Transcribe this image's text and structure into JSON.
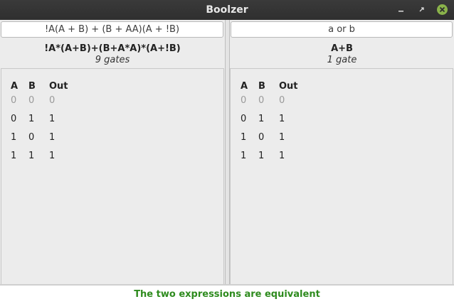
{
  "window": {
    "title": "Boolzer",
    "controls": [
      "minimize-icon",
      "maximize-icon",
      "close-icon"
    ],
    "close_color": "#8ab34a"
  },
  "left": {
    "input_value": "!A(A + B) + (B + AA)(A + !B)",
    "simplified": "!A*(A+B)+(B+A*A)*(A+!B)",
    "gate_count": "9 gates",
    "table": {
      "headers": [
        "A",
        "B",
        "Out"
      ],
      "rows": [
        [
          "0",
          "0",
          "0"
        ],
        [
          "0",
          "1",
          "1"
        ],
        [
          "1",
          "0",
          "1"
        ],
        [
          "1",
          "1",
          "1"
        ]
      ]
    }
  },
  "right": {
    "input_value": "a or b",
    "simplified": "A+B",
    "gate_count": "1 gate",
    "table": {
      "headers": [
        "A",
        "B",
        "Out"
      ],
      "rows": [
        [
          "0",
          "0",
          "0"
        ],
        [
          "0",
          "1",
          "1"
        ],
        [
          "1",
          "0",
          "1"
        ],
        [
          "1",
          "1",
          "1"
        ]
      ]
    }
  },
  "status": {
    "message": "The two expressions are equivalent",
    "color": "#2e8b1e"
  }
}
